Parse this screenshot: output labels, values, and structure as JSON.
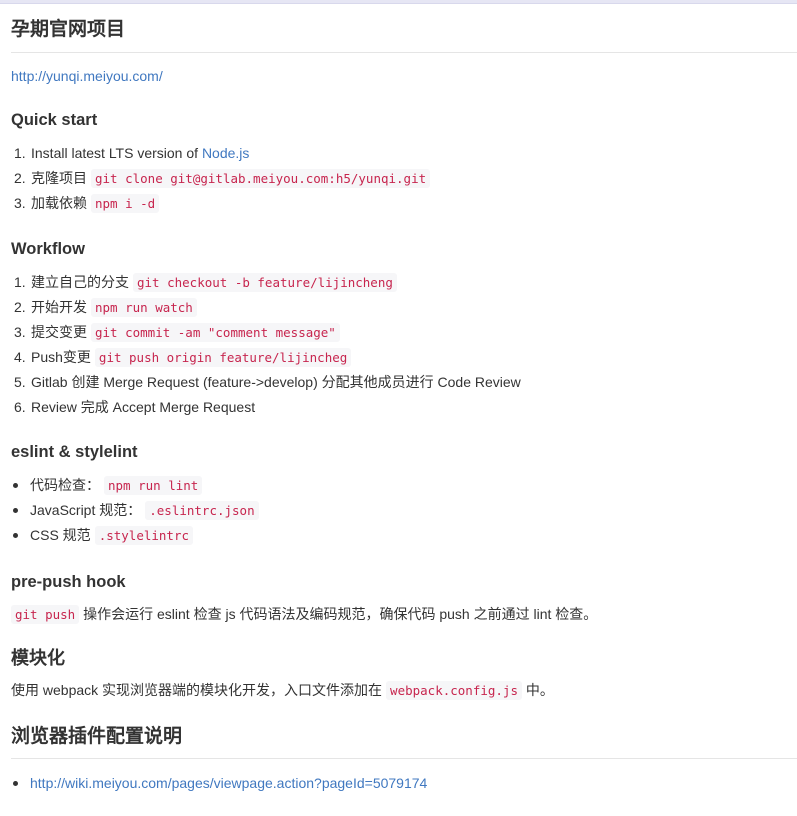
{
  "title": "孕期官网项目",
  "site_url": "http://yunqi.meiyou.com/",
  "quick_start": {
    "heading": "Quick start",
    "items": [
      {
        "num": "1.",
        "text": "Install latest LTS version of ",
        "link": "Node.js",
        "code": ""
      },
      {
        "num": "2.",
        "text": "克隆项目",
        "link": "",
        "code": "git clone git@gitlab.meiyou.com:h5/yunqi.git"
      },
      {
        "num": "3.",
        "text": "加载依赖",
        "link": "",
        "code": "npm i -d"
      }
    ]
  },
  "workflow": {
    "heading": "Workflow",
    "items": [
      {
        "num": "1.",
        "text": "建立自己的分支",
        "code": "git checkout -b feature/lijincheng"
      },
      {
        "num": "2.",
        "text": "开始开发",
        "code": "npm run watch"
      },
      {
        "num": "3.",
        "text": "提交变更",
        "code": "git commit -am \"comment message\""
      },
      {
        "num": "4.",
        "text": "Push变更",
        "code": "git push origin feature/lijincheg"
      },
      {
        "num": "5.",
        "text": "Gitlab 创建 Merge Request (feature->develop) 分配其他成员进行 Code Review",
        "code": ""
      },
      {
        "num": "6.",
        "text": "Review 完成 Accept Merge Request",
        "code": ""
      }
    ]
  },
  "lint": {
    "heading": "eslint & stylelint",
    "items": [
      {
        "text": "代码检查：",
        "code": "npm run lint"
      },
      {
        "text": "JavaScript 规范：",
        "code": ".eslintrc.json"
      },
      {
        "text": "CSS 规范",
        "code": ".stylelintrc"
      }
    ]
  },
  "prepush": {
    "heading": "pre-push hook",
    "code": "git push",
    "text": " 操作会运行 eslint 检查 js 代码语法及编码规范，确保代码 push 之前通过 lint 检查。"
  },
  "modular": {
    "heading": "模块化",
    "text_before": "使用 webpack 实现浏览器端的模块化开发，入口文件添加在",
    "code": "webpack.config.js",
    "text_after": " 中。"
  },
  "plugins": {
    "heading": "浏览器插件配置说明",
    "link": "http://wiki.meiyou.com/pages/viewpage.action?pageId=5079174"
  },
  "colors": {
    "link": "#4078c0",
    "code_text": "#c7254e",
    "code_bg": "#f6f6f8",
    "text": "#333333"
  }
}
